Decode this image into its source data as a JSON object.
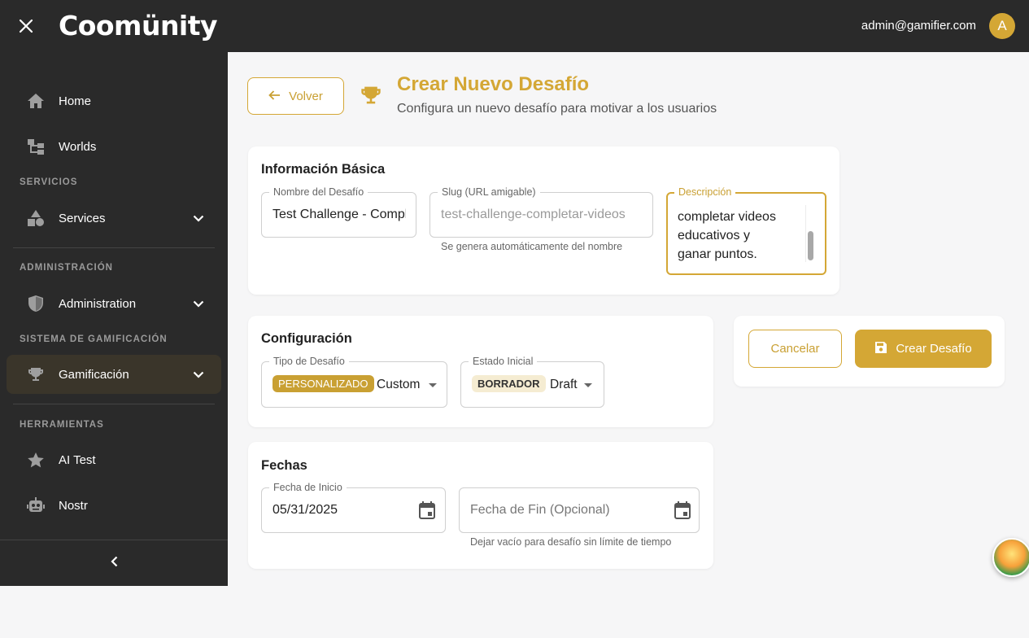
{
  "topbar": {
    "logo_text": "Coomünity",
    "user_email": "admin@gamifier.com",
    "avatar_initial": "A"
  },
  "sidebar": {
    "items": [
      {
        "label": "Home",
        "icon": "home-icon"
      },
      {
        "label": "Worlds",
        "icon": "worlds-icon"
      },
      {
        "label": "Services",
        "icon": "services-icon"
      },
      {
        "label": "Administration",
        "icon": "shield-icon"
      },
      {
        "label": "Gamificación",
        "icon": "trophy-icon"
      },
      {
        "label": "AI Test",
        "icon": "star-icon"
      },
      {
        "label": "Nostr",
        "icon": "robot-icon"
      }
    ],
    "sections": {
      "servicios": "SERVICIOS",
      "administracion": "ADMINISTRACIÓN",
      "gamificacion": "SISTEMA DE GAMIFICACIÓN",
      "herramientas": "HERRAMIENTAS"
    }
  },
  "header": {
    "back_label": "Volver",
    "title": "Crear Nuevo Desafío",
    "subtitle": "Configura un nuevo desafío para motivar a los usuarios"
  },
  "basic_info": {
    "title": "Información Básica",
    "name": {
      "label": "Nombre del Desafío",
      "value": "Test Challenge - Completar Videos"
    },
    "slug": {
      "label": "Slug (URL amigable)",
      "value": "test-challenge-completar-videos",
      "helper": "Se genera automáticamente del nombre"
    },
    "description": {
      "label": "Descripción",
      "lines": [
        "completar videos",
        "educativos y",
        "ganar puntos."
      ]
    }
  },
  "config": {
    "title": "Configuración",
    "type": {
      "label": "Tipo de Desafío",
      "chip": "PERSONALIZADO",
      "value": "Custom"
    },
    "status": {
      "label": "Estado Inicial",
      "chip": "BORRADOR",
      "value": "Draft"
    }
  },
  "dates": {
    "title": "Fechas",
    "start": {
      "label": "Fecha de Inicio",
      "value": "05/31/2025"
    },
    "end": {
      "placeholder": "Fecha de Fin (Opcional)",
      "helper": "Dejar vacío para desafío sin límite de tiempo"
    }
  },
  "actions": {
    "cancel": "Cancelar",
    "create": "Crear Desafío"
  },
  "colors": {
    "accent": "#d4a735",
    "sidebar_bg": "#2a2a2a",
    "page_bg": "#f6f6f7"
  }
}
